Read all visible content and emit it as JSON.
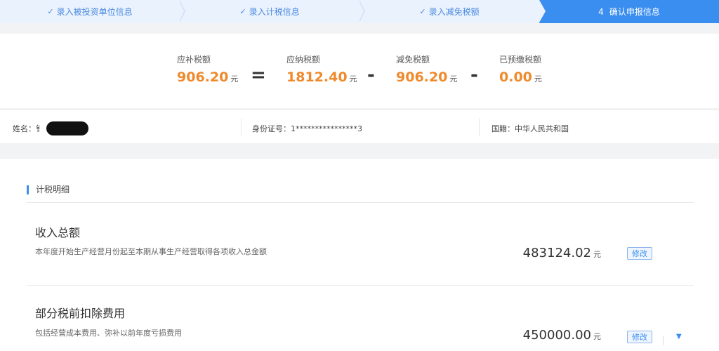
{
  "steps": [
    {
      "label": "录入被投资单位信息",
      "done": true
    },
    {
      "label": "录入计税信息",
      "done": true
    },
    {
      "label": "录入减免税额",
      "done": true
    },
    {
      "num": "4",
      "label": "确认申报信息",
      "active": true
    }
  ],
  "summary": {
    "payable": {
      "label": "应补税额",
      "value": "906.20",
      "unit": "元"
    },
    "due": {
      "label": "应纳税额",
      "value": "1812.40",
      "unit": "元"
    },
    "relief": {
      "label": "减免税额",
      "value": "906.20",
      "unit": "元"
    },
    "prepaid": {
      "label": "已预缴税额",
      "value": "0.00",
      "unit": "元"
    },
    "ops": {
      "eq": "=",
      "minus1": "-",
      "minus2": "-"
    }
  },
  "info": {
    "name_label": "姓名：",
    "name_value": "钅",
    "id_label": "身份证号：",
    "id_value": "1****************3",
    "nation_label": "国籍：",
    "nation_value": "中华人民共和国"
  },
  "detail": {
    "section_title": "计税明细",
    "rows": [
      {
        "title": "收入总额",
        "desc": "本年度开始生产经营月份起至本期从事生产经营取得各项收入总金额",
        "amount": "483124.02",
        "unit": "元",
        "button": "修改"
      },
      {
        "title": "部分税前扣除费用",
        "desc": "包括经营成本费用、弥补以前年度亏损费用",
        "amount": "450000.00",
        "unit": "元",
        "button": "修改"
      }
    ]
  },
  "colors": {
    "accent": "#3a8ef0",
    "amount": "#ef8a2c"
  }
}
